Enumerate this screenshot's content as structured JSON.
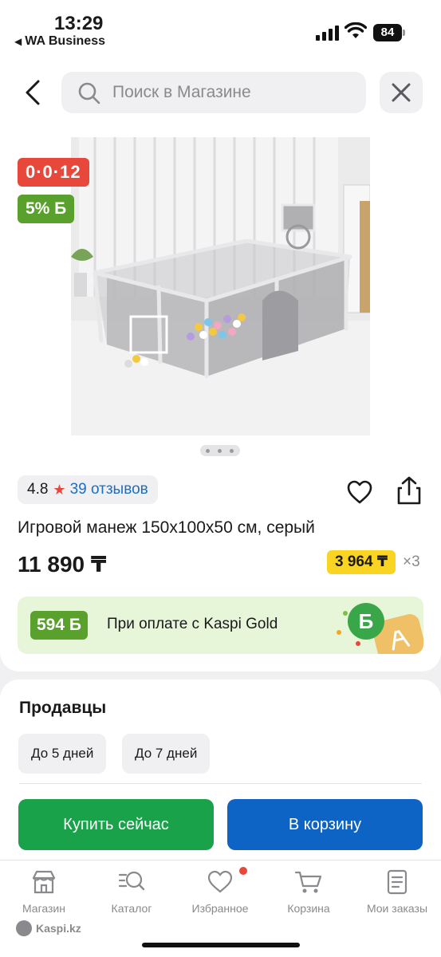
{
  "status_bar": {
    "time": "13:29",
    "back_app": "WA Business",
    "battery": "84"
  },
  "header": {
    "search_placeholder": "Поиск в Магазине"
  },
  "product": {
    "timer_badge": "0·0·12",
    "bonus_badge": "5% Б",
    "rating": "4.8",
    "reviews": "39 отзывов",
    "title": "Игровой манеж 150x100x50 см, серый",
    "price": "11 890 ₸",
    "installment": "3 964 ₸",
    "installment_multiplier": "×3",
    "image_count": 3,
    "active_image": 1
  },
  "kaspi_gold": {
    "bonus": "594 Б",
    "text": "При оплате с Kaspi Gold",
    "coin": "Б"
  },
  "sellers": {
    "title": "Продавцы",
    "chips": [
      "До 5 дней",
      "До 7 дней"
    ],
    "buy_label": "Купить сейчас",
    "cart_label": "В корзину"
  },
  "nav": {
    "items": [
      {
        "label": "Магазин",
        "icon": "store-icon"
      },
      {
        "label": "Каталог",
        "icon": "catalog-search-icon"
      },
      {
        "label": "Избранное",
        "icon": "heart-icon"
      },
      {
        "label": "Корзина",
        "icon": "cart-icon"
      },
      {
        "label": "Мои заказы",
        "icon": "orders-icon"
      }
    ]
  },
  "footer": {
    "site": "Kaspi.kz"
  },
  "colors": {
    "accent_red": "#e8473c",
    "bonus_green": "#5aa02c",
    "buy_green": "#19a24a",
    "cart_blue": "#0d64c4",
    "installment_yellow": "#f9d423"
  }
}
